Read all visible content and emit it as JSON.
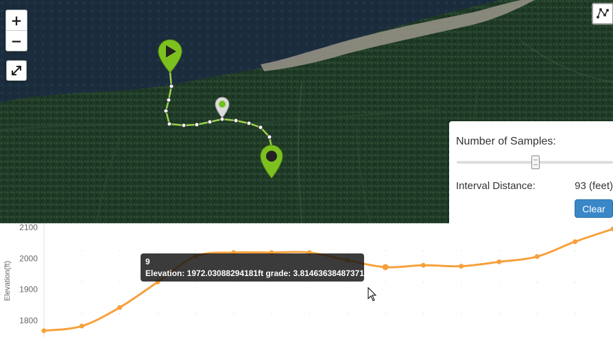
{
  "map": {
    "zoom_in_label": "+",
    "zoom_out_label": "−",
    "route_markers": [
      "start-marker",
      "position-marker",
      "end-marker"
    ]
  },
  "panel": {
    "samples_label": "Number of Samples:",
    "samples_slider_position": 0.5,
    "interval_label": "Interval Distance:",
    "interval_value": "93 (feet)",
    "clear_label": "Clear"
  },
  "tooltip": {
    "title": "9",
    "body": "Elevation: 1972.03088294181ft  grade: 3.81463638487371"
  },
  "chart_data": {
    "type": "line",
    "ylabel": "Elevation(ft)",
    "yticks": [
      "2100",
      "2000",
      "1900",
      "1800"
    ],
    "ylim": [
      1760,
      2100
    ],
    "x": [
      1,
      2,
      3,
      4,
      5,
      6,
      7,
      8,
      9,
      10,
      11,
      12,
      13,
      14,
      15
    ],
    "series": [
      {
        "values": [
          1767,
          1782,
          1842,
          1924,
          2007,
          2019,
          2019,
          2019,
          1994,
          1972,
          1978,
          1975,
          1989,
          2006,
          2054,
          2095
        ]
      }
    ],
    "highlight_index": 9,
    "colors": {
      "line": "#f7a03b",
      "point": "#f7a03b"
    }
  }
}
